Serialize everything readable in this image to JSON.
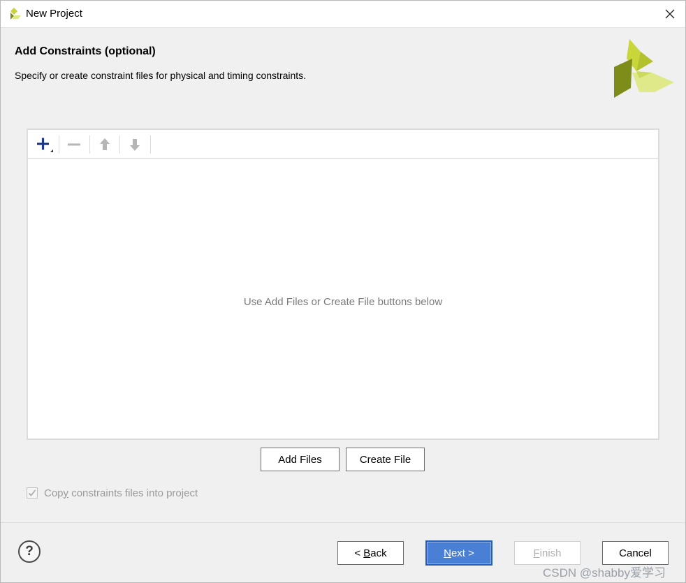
{
  "window": {
    "title": "New Project",
    "close_icon": "close-icon"
  },
  "header": {
    "title": "Add Constraints (optional)",
    "subtitle": "Specify or create constraint files for physical and timing constraints."
  },
  "file_panel": {
    "toolbar": {
      "add_icon": "plus-icon",
      "remove_icon": "minus-icon",
      "up_icon": "arrow-up-icon",
      "down_icon": "arrow-down-icon"
    },
    "empty_message": "Use Add Files or Create File buttons below"
  },
  "actions": {
    "add_files": "Add Files",
    "create_file": "Create File"
  },
  "options": {
    "copy_checked": true,
    "copy_label_mnemonic": "y",
    "copy_label_pre": "Cop",
    "copy_label_post": " constraints files into project"
  },
  "footer": {
    "help": "?",
    "back_prefix": "< ",
    "back_mnemonic": "B",
    "back_rest": "ack",
    "next_mnemonic": "N",
    "next_rest": "ext >",
    "finish_mnemonic": "F",
    "finish_rest": "inish",
    "cancel": "Cancel"
  },
  "watermark": "CSDN @shabby爱学习",
  "colors": {
    "primary_button": "#4a7fd6",
    "logo_light": "#d7e84a",
    "logo_dark": "#8c9a1e"
  }
}
